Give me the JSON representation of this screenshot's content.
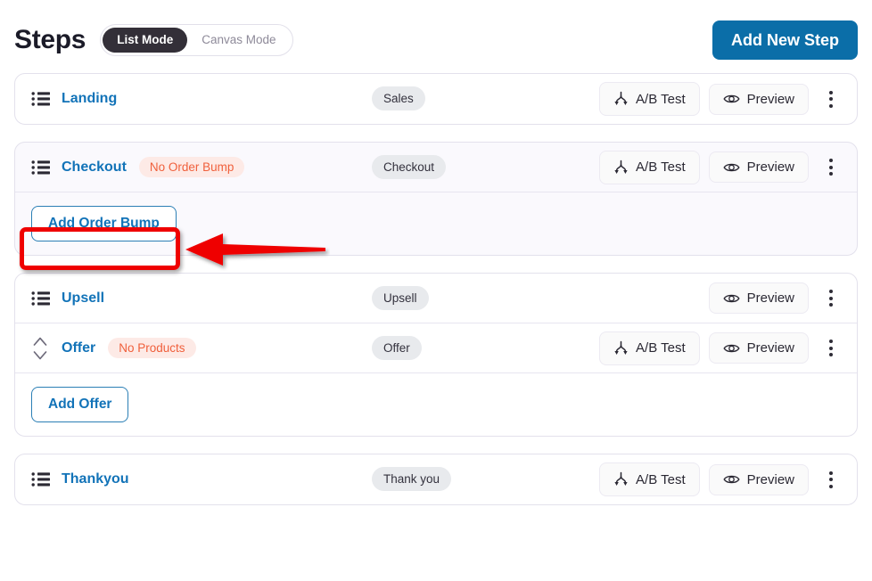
{
  "header": {
    "title": "Steps",
    "modes": [
      {
        "label": "List Mode",
        "active": true
      },
      {
        "label": "Canvas Mode",
        "active": false
      }
    ],
    "add_step_label": "Add New Step"
  },
  "colors": {
    "primary_button": "#0b6ea8",
    "link": "#1273b8",
    "warning_badge_text": "#f0603c",
    "warning_badge_bg": "#fdeae6",
    "type_pill_bg": "#e8eaed",
    "toggle_active_bg": "#332f38",
    "annotation": "#ef0000",
    "card_border": "#e3e1ec",
    "checkout_card_bg": "#faf9fd"
  },
  "labels": {
    "ab_test": "A/B Test",
    "preview": "Preview"
  },
  "icons": {
    "handle": "list-icon",
    "sort": "sort-updown-icon",
    "ab_test": "split-branch-icon",
    "preview": "eye-icon",
    "menu": "kebab-menu-icon"
  },
  "cards": [
    {
      "id": "landing",
      "tinted": false,
      "rows": [
        {
          "name": "Landing",
          "handle_icon": "list-icon",
          "badge": null,
          "type_pill": "Sales",
          "has_ab_test": true,
          "has_preview": true,
          "has_menu": true
        }
      ],
      "sub_action": null
    },
    {
      "id": "checkout",
      "tinted": true,
      "rows": [
        {
          "name": "Checkout",
          "handle_icon": "list-icon",
          "badge": "No Order Bump",
          "type_pill": "Checkout",
          "has_ab_test": true,
          "has_preview": true,
          "has_menu": true
        }
      ],
      "sub_action": "Add Order Bump"
    },
    {
      "id": "upsell",
      "tinted": false,
      "rows": [
        {
          "name": "Upsell",
          "handle_icon": "list-icon",
          "badge": null,
          "type_pill": "Upsell",
          "has_ab_test": false,
          "has_preview": true,
          "has_menu": true
        },
        {
          "name": "Offer",
          "handle_icon": "sort-updown-icon",
          "badge": "No Products",
          "type_pill": "Offer",
          "has_ab_test": true,
          "has_preview": true,
          "has_menu": true
        }
      ],
      "sub_action": "Add Offer"
    },
    {
      "id": "thankyou",
      "tinted": false,
      "rows": [
        {
          "name": "Thankyou",
          "handle_icon": "list-icon",
          "badge": null,
          "type_pill": "Thank you",
          "has_ab_test": true,
          "has_preview": true,
          "has_menu": true
        }
      ],
      "sub_action": null
    }
  ],
  "annotation": {
    "type": "arrow-pointing-left",
    "target": "Add Order Bump",
    "color": "#ef0000"
  }
}
